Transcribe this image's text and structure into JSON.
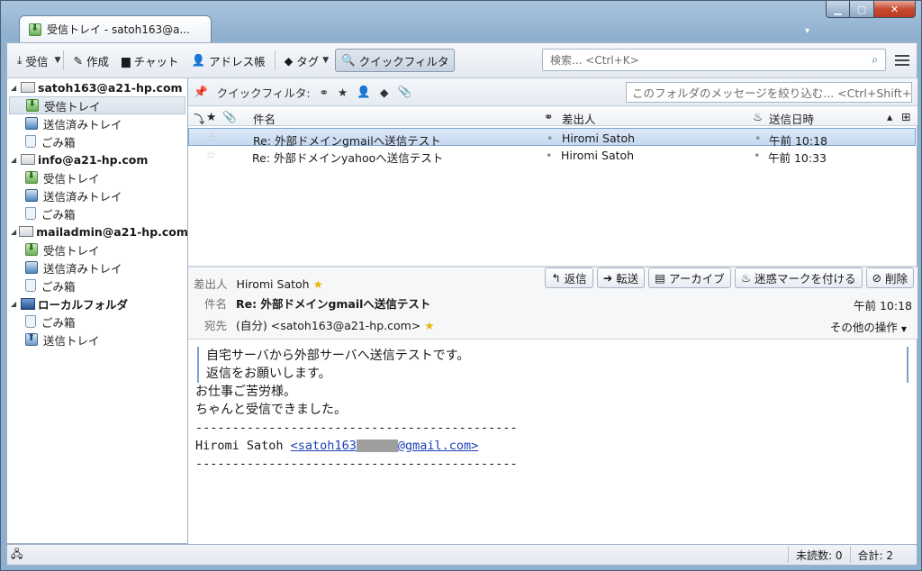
{
  "window": {
    "tab_title": "受信トレイ - satoh163@a..."
  },
  "toolbar": {
    "get_mail": "受信",
    "write": "作成",
    "chat": "チャット",
    "address_book": "アドレス帳",
    "tag": "タグ",
    "quick_filter": "クイックフィルタ",
    "search_placeholder": "検索... <Ctrl+K>"
  },
  "folders": {
    "accounts": [
      {
        "name": "satoh163@a21-hp.com",
        "folders": [
          "受信トレイ",
          "送信済みトレイ",
          "ごみ箱"
        ]
      },
      {
        "name": "info@a21-hp.com",
        "folders": [
          "受信トレイ",
          "送信済みトレイ",
          "ごみ箱"
        ]
      },
      {
        "name": "mailadmin@a21-hp.com",
        "folders": [
          "受信トレイ",
          "送信済みトレイ",
          "ごみ箱"
        ]
      },
      {
        "name": "ローカルフォルダ",
        "folders": [
          "ごみ箱",
          "送信トレイ"
        ]
      }
    ]
  },
  "quickfilter": {
    "label": "クイックフィルタ:",
    "filter_placeholder": "このフォルダのメッセージを絞り込む... <Ctrl+Shift+K>"
  },
  "thread": {
    "columns": {
      "subject": "件名",
      "sender": "差出人",
      "date": "送信日時"
    },
    "rows": [
      {
        "subject": "Re: 外部ドメインgmailへ送信テスト",
        "sender": "Hiromi Satoh",
        "date": "午前 10:18"
      },
      {
        "subject": "Re: 外部ドメインyahooへ送信テスト",
        "sender": "Hiromi Satoh",
        "date": "午前 10:33"
      }
    ]
  },
  "message": {
    "from_label": "差出人",
    "from": "Hiromi Satoh",
    "subject_label": "件名",
    "subject": "Re: 外部ドメインgmailへ送信テスト",
    "to_label": "宛先",
    "to": "(自分) <satoh163@a21-hp.com>",
    "time": "午前 10:18",
    "more_actions": "その他の操作",
    "actions": {
      "reply": "返信",
      "forward": "転送",
      "archive": "アーカイブ",
      "junk": "迷惑マークを付ける",
      "delete": "削除"
    },
    "quote_lines": [
      "自宅サーバから外部サーバへ送信テストです。",
      "返信をお願いします。"
    ],
    "body_lines": [
      "お仕事ご苦労様。",
      "ちゃんと受信できました。"
    ],
    "separator": "--------------------------------------------",
    "sig_name": "Hiromi Satoh ",
    "sig_link_prefix": "<satoh163",
    "sig_link_suffix": "@gmail.com>"
  },
  "status": {
    "unread": "未読数: 0",
    "total": "合計: 2"
  }
}
